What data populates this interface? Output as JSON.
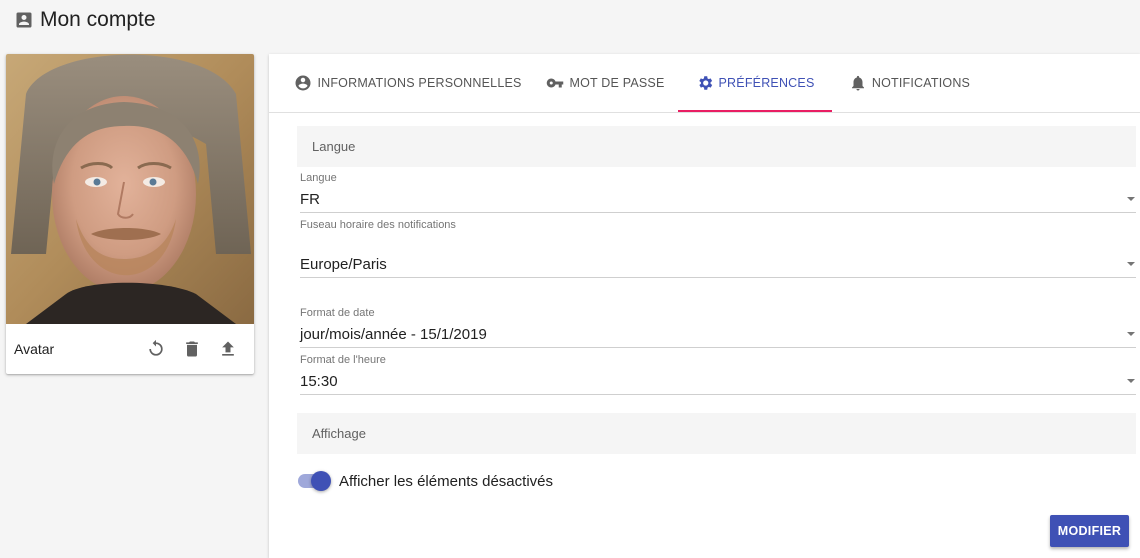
{
  "page": {
    "title": "Mon compte",
    "title_icon": "account-box-icon"
  },
  "avatar": {
    "label": "Avatar",
    "actions": [
      "refresh-icon",
      "delete-icon",
      "upload-icon"
    ]
  },
  "tabs": [
    {
      "label": "INFORMATIONS PERSONNELLES",
      "icon": "account-circle-icon",
      "active": false
    },
    {
      "label": "MOT DE PASSE",
      "icon": "key-icon",
      "active": false
    },
    {
      "label": "PRÉFÉRENCES",
      "icon": "gear-icon",
      "active": true
    },
    {
      "label": "NOTIFICATIONS",
      "icon": "bell-icon",
      "active": false
    }
  ],
  "sections": {
    "language": "Langue",
    "display": "Affichage"
  },
  "fields": {
    "language": {
      "label": "Langue",
      "value": "FR"
    },
    "timezone": {
      "label": "Fuseau horaire des notifications",
      "value": "Europe/Paris"
    },
    "date_format": {
      "label": "Format de date",
      "value": "jour/mois/année - 15/1/2019"
    },
    "time_format": {
      "label": "Format de l'heure",
      "value": "15:30"
    }
  },
  "toggle": {
    "label": "Afficher les éléments désactivés",
    "checked": true
  },
  "submit_label": "MODIFIER",
  "colors": {
    "primary": "#3f51b5",
    "tab_indicator": "#e91e63"
  }
}
